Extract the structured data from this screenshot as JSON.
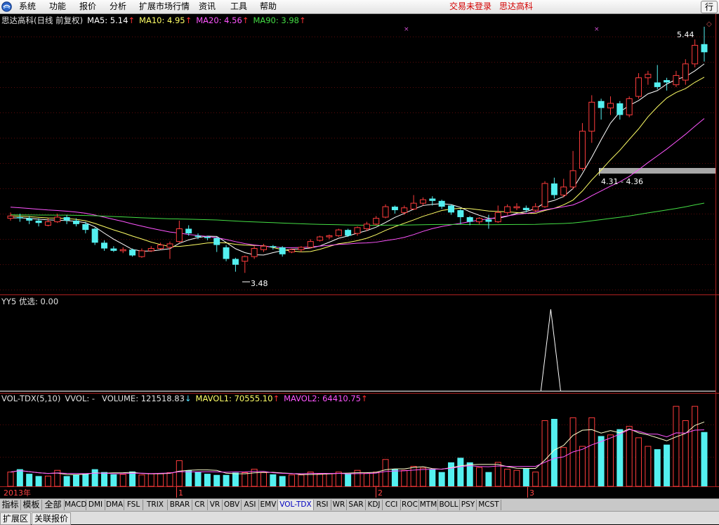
{
  "menu": {
    "items": [
      "系统",
      "功能",
      "报价",
      "分析",
      "扩展市场行情",
      "资讯",
      "工具",
      "帮助"
    ],
    "trade_status": "交易未登录",
    "stock_name": "思达高科",
    "corner_button": "行"
  },
  "price_header": {
    "title": "思达高科(日线 前复权)",
    "ma5": "MA5: 5.14",
    "ma10": "MA10: 4.95",
    "ma20": "MA20: 4.56",
    "ma90": "MA90: 3.98",
    "up_arrow": "↑"
  },
  "price_annotations": {
    "high_label": "5.44",
    "low_label": "3.48",
    "band_label": "4.31 - 4.36"
  },
  "indicator_header": {
    "text": "YY5 优选: 0.00"
  },
  "volume_header": {
    "name": "VOL-TDX(5,10)",
    "vvol": "VVOL: -",
    "volume": "VOLUME: 121518.83",
    "mavol1": "MAVOL1: 70555.10",
    "mavol2": "MAVOL2: 64410.75",
    "up_arrow": "↑",
    "down_arrow": "↓"
  },
  "x_axis": {
    "year_label": "2013年",
    "month_labels": [
      "1",
      "2",
      "3"
    ]
  },
  "tabs": [
    "指标",
    "模板",
    "全部",
    "MACD",
    "DMI",
    "DMA",
    "FSL",
    "TRIX",
    "BRAR",
    "CR",
    "VR",
    "OBV",
    "ASI",
    "EMV",
    "VOL-TDX",
    "RSI",
    "WR",
    "SAR",
    "KDJ",
    "CCI",
    "ROC",
    "MTM",
    "BOLL",
    "PSY",
    "MCST"
  ],
  "bottom_tabs": [
    "扩展区",
    "关联报价"
  ],
  "colors": {
    "up": "#ff3c3c",
    "down": "#54f0f0",
    "ma5": "#ffffff",
    "ma10": "#ffff66",
    "ma20": "#ff55ff",
    "ma90": "#44dd44"
  },
  "chart_data": {
    "type": "candlestick",
    "price_ylim": [
      3.3,
      5.6
    ],
    "candles": [
      [
        3.95,
        3.97,
        4.0,
        3.93
      ],
      [
        3.96,
        3.95,
        3.99,
        3.92
      ],
      [
        3.95,
        3.93,
        3.97,
        3.9
      ],
      [
        3.93,
        3.91,
        3.95,
        3.88
      ],
      [
        3.89,
        3.92,
        3.95,
        3.88
      ],
      [
        3.92,
        3.96,
        3.99,
        3.91
      ],
      [
        3.96,
        3.93,
        3.98,
        3.9
      ],
      [
        3.93,
        3.9,
        3.95,
        3.88
      ],
      [
        3.9,
        3.85,
        3.92,
        3.82
      ],
      [
        3.86,
        3.74,
        3.87,
        3.72
      ],
      [
        3.74,
        3.69,
        3.76,
        3.67
      ],
      [
        3.69,
        3.67,
        3.71,
        3.66
      ],
      [
        3.67,
        3.68,
        3.7,
        3.65
      ],
      [
        3.68,
        3.63,
        3.69,
        3.62
      ],
      [
        3.62,
        3.67,
        3.69,
        3.61
      ],
      [
        3.67,
        3.69,
        3.71,
        3.66
      ],
      [
        3.69,
        3.72,
        3.74,
        3.68
      ],
      [
        3.7,
        3.73,
        3.75,
        3.6
      ],
      [
        3.75,
        3.86,
        3.93,
        3.74
      ],
      [
        3.86,
        3.82,
        3.89,
        3.8
      ],
      [
        3.8,
        3.79,
        3.82,
        3.77
      ],
      [
        3.79,
        3.78,
        3.8,
        3.76
      ],
      [
        3.78,
        3.72,
        3.79,
        3.66
      ],
      [
        3.7,
        3.6,
        3.72,
        3.58
      ],
      [
        3.6,
        3.55,
        3.61,
        3.49
      ],
      [
        3.58,
        3.62,
        3.63,
        3.48
      ],
      [
        3.62,
        3.69,
        3.71,
        3.6
      ],
      [
        3.68,
        3.71,
        3.73,
        3.66
      ],
      [
        3.71,
        3.7,
        3.72,
        3.68
      ],
      [
        3.7,
        3.64,
        3.71,
        3.62
      ],
      [
        3.66,
        3.68,
        3.69,
        3.65
      ],
      [
        3.68,
        3.7,
        3.71,
        3.66
      ],
      [
        3.7,
        3.75,
        3.77,
        3.69
      ],
      [
        3.76,
        3.79,
        3.8,
        3.75
      ],
      [
        3.79,
        3.8,
        3.81,
        3.77
      ],
      [
        3.8,
        3.85,
        3.86,
        3.79
      ],
      [
        3.85,
        3.8,
        3.86,
        3.79
      ],
      [
        3.82,
        3.87,
        3.88,
        3.8
      ],
      [
        3.86,
        3.9,
        3.92,
        3.84
      ],
      [
        3.9,
        3.95,
        3.97,
        3.89
      ],
      [
        3.96,
        4.05,
        4.07,
        3.95
      ],
      [
        4.05,
        4.02,
        4.06,
        3.99
      ],
      [
        4.0,
        4.04,
        4.06,
        3.98
      ],
      [
        4.03,
        4.08,
        4.15,
        4.02
      ],
      [
        4.08,
        4.11,
        4.13,
        4.06
      ],
      [
        4.12,
        4.1,
        4.14,
        4.06
      ],
      [
        4.1,
        4.05,
        4.11,
        4.03
      ],
      [
        4.06,
        4.0,
        4.07,
        3.98
      ],
      [
        4.02,
        3.96,
        4.03,
        3.9
      ],
      [
        3.96,
        3.92,
        3.97,
        3.89
      ],
      [
        3.92,
        3.95,
        3.96,
        3.9
      ],
      [
        3.94,
        3.92,
        3.98,
        3.86
      ],
      [
        3.92,
        4.0,
        4.06,
        3.91
      ],
      [
        4.0,
        4.05,
        4.07,
        3.98
      ],
      [
        4.04,
        4.05,
        4.08,
        4.02
      ],
      [
        4.04,
        4.02,
        4.06,
        4.0
      ],
      [
        4.02,
        4.05,
        4.08,
        4.0
      ],
      [
        4.05,
        4.25,
        4.27,
        4.04
      ],
      [
        4.25,
        4.15,
        4.3,
        4.12
      ],
      [
        4.15,
        4.22,
        4.29,
        4.13
      ],
      [
        4.22,
        4.36,
        4.53,
        4.2
      ],
      [
        4.38,
        4.7,
        4.77,
        4.36
      ],
      [
        4.7,
        4.95,
        5.01,
        4.6
      ],
      [
        4.96,
        4.9,
        4.98,
        4.8
      ],
      [
        4.9,
        4.94,
        5.0,
        4.84
      ],
      [
        4.94,
        4.84,
        4.96,
        4.8
      ],
      [
        4.84,
        4.98,
        5.0,
        4.82
      ],
      [
        5.0,
        5.16,
        5.2,
        4.98
      ],
      [
        5.16,
        5.19,
        5.22,
        5.1
      ],
      [
        5.12,
        5.08,
        5.27,
        5.06
      ],
      [
        5.14,
        5.12,
        5.16,
        5.05
      ],
      [
        5.1,
        5.18,
        5.22,
        5.08
      ],
      [
        5.14,
        5.28,
        5.32,
        5.1
      ],
      [
        5.28,
        5.44,
        5.49,
        5.25
      ],
      [
        5.45,
        5.38,
        5.6,
        5.3
      ]
    ],
    "ma5_color_hint": "white",
    "indicator_series": {
      "name": "YY5 优选",
      "spike_index": 58,
      "spike_value": 1.0
    },
    "volume": [
      25,
      30,
      22,
      18,
      18,
      28,
      18,
      20,
      22,
      30,
      25,
      21,
      21,
      26,
      20,
      22,
      22,
      24,
      45,
      28,
      25,
      22,
      20,
      20,
      24,
      24,
      30,
      24,
      21,
      18,
      20,
      20,
      25,
      22,
      22,
      25,
      22,
      28,
      23,
      25,
      47,
      30,
      28,
      35,
      32,
      30,
      25,
      42,
      50,
      42,
      33,
      25,
      42,
      30,
      28,
      32,
      25,
      115,
      118,
      68,
      120,
      70,
      120,
      88,
      90,
      100,
      105,
      85,
      70,
      65,
      73,
      140,
      115,
      140,
      95
    ]
  }
}
